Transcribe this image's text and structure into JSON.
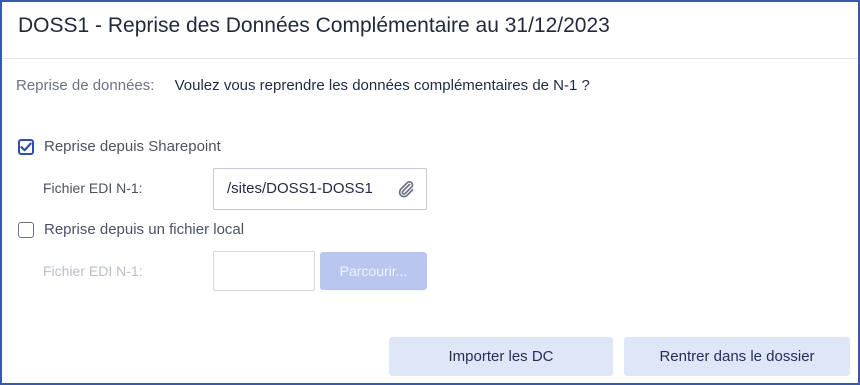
{
  "dialog": {
    "title": "DOSS1 - Reprise des Données Complémentaire au 31/12/2023"
  },
  "prompt": {
    "label": "Reprise de données:",
    "text": "Voulez vous reprendre les données complémentaires de N-1 ?"
  },
  "sharepoint": {
    "checkbox_label": "Reprise depuis Sharepoint",
    "checked": true,
    "field_label": "Fichier EDI N-1:",
    "field_value": "/sites/DOSS1-DOSS1",
    "icon": "paperclip-icon"
  },
  "local": {
    "checkbox_label": "Reprise depuis un fichier local",
    "checked": false,
    "field_label": "Fichier EDI N-1:",
    "field_value": "",
    "browse_label": "Parcourir..."
  },
  "actions": {
    "import_label": "Importer les DC",
    "back_label": "Rentrer dans le dossier"
  },
  "colors": {
    "accent": "#2f4fb0",
    "border": "#3a5aa8",
    "button_bg": "#dfe6f7",
    "disabled_button_bg": "#b9c7ee"
  }
}
